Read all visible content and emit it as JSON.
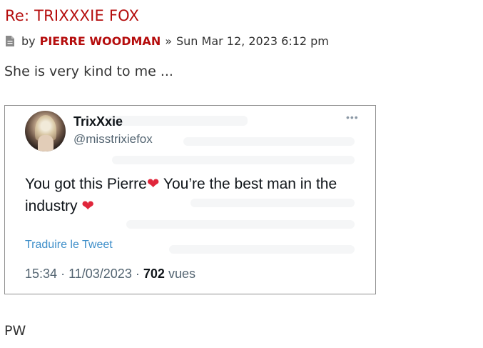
{
  "post": {
    "title": "Re: TRIXXXIE FOX",
    "meta": {
      "icon": "post-file-icon",
      "by_label": "by",
      "author": "PIERRE WOODMAN",
      "separator": "»",
      "timestamp": "Sun Mar 12, 2023 6:12 pm"
    },
    "text": "She is very kind to me ...",
    "signature": "PW",
    "colors": {
      "title": "#b50d0d",
      "author": "#b50d0d",
      "text": "#333333"
    }
  },
  "tweet": {
    "display_name": "TrixXxie",
    "handle": "@misstrixiefox",
    "more_icon": "ellipsis-icon",
    "body": {
      "part1": "You got this Pierre",
      "part2": " You’re the best man in the industry ",
      "emoji": "❤"
    },
    "translate_label": "Traduire le Tweet",
    "time": "15:34",
    "dot": "·",
    "date": "11/03/2023",
    "views_count": "702",
    "views_label": "vues",
    "colors": {
      "name": "#0f1419",
      "muted": "#536471",
      "link": "#3d8ec9",
      "heart": "#e0263b"
    }
  }
}
